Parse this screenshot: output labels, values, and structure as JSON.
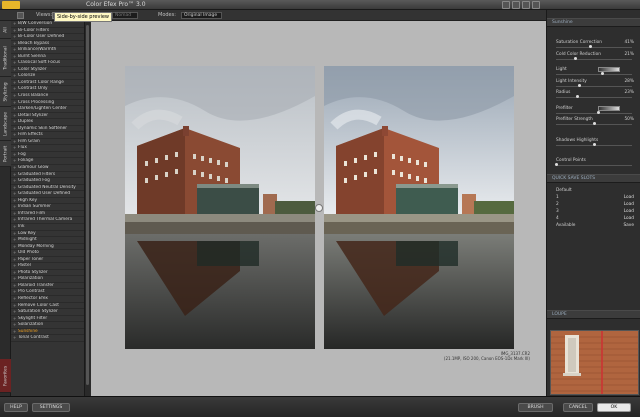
{
  "window": {
    "title": "Color Efex Pro",
    "version_sup": "™",
    "version": "3.0"
  },
  "toolbar": {
    "views_label": "Views:",
    "mode_label": "Modes:",
    "mode_value": "Original Image",
    "tooltip": "Side-by-side preview",
    "zoom_value": "Nomad"
  },
  "tabs": [
    "All",
    "Traditional",
    "Stylizing",
    "Landscape",
    "Portrait",
    "Favorites"
  ],
  "filters": [
    "B/W Conversion",
    "Bi-Color Filters",
    "Bi-Color User Defined",
    "Bleach Bypass",
    "Brilliance/Warmth",
    "Burnt Sienna",
    "Classical Soft Focus",
    "Color Stylizer",
    "Colorize",
    "Contrast Color Range",
    "Contrast Only",
    "Cross Balance",
    "Cross Processing",
    "Darken/Lighten Center",
    "Detail Stylizer",
    "Duplex",
    "Dynamic Skin Softener",
    "Film Effects",
    "Film Grain",
    "Flux",
    "Fog",
    "Foliage",
    "Glamour Glow",
    "Graduated Filters",
    "Graduated Fog",
    "Graduated Neutral Density",
    "Graduated User Defined",
    "High Key",
    "Indian Summer",
    "Infrared Film",
    "Infrared Thermal Camera",
    "Ink",
    "Low Key",
    "Midnight",
    "Monday Morning",
    "Old Photo",
    "Paper Toner",
    "Pastel",
    "Photo Stylizer",
    "Polarization",
    "Polaroid Transfer",
    "Pro Contrast",
    "Reflector Efex",
    "Remove Color Cast",
    "Saturation Stylizer",
    "Skylight Filter",
    "Solarization",
    "Sunshine",
    "Tonal Contrast"
  ],
  "active_filter": "Sunshine",
  "image_caption": {
    "file": "IMG_3137.CR2",
    "meta": "(21.1MP, ISO 200, Canon EOS-1Ds Mark III)"
  },
  "panel": {
    "filter_title": "Sunshine",
    "params": [
      {
        "label": "Saturation Correction",
        "value": "41%",
        "knob": 0.45
      },
      {
        "label": "Cold Color Reduction",
        "value": "21%",
        "knob": 0.25
      },
      {
        "label": "Light",
        "value": "",
        "knob": 0.6,
        "gradient": true
      },
      {
        "label": "Light Intensity",
        "value": "28%",
        "knob": 0.3
      },
      {
        "label": "Radius",
        "value": "23%",
        "knob": 0.28
      },
      {
        "label": "Prefilter",
        "value": "",
        "knob": 0.55,
        "gradient": true
      },
      {
        "label": "Prefilter Strength",
        "value": "50%",
        "knob": 0.5
      },
      {
        "label": "Shadows Highlights",
        "value": "",
        "knob": 0.5
      },
      {
        "label": "Control Points",
        "value": "",
        "knob": 0.0
      }
    ],
    "quick_save_title": "QUICK SAVE SLOTS",
    "slots": [
      {
        "name": "Default",
        "action": ""
      },
      {
        "name": "1",
        "action": "Load"
      },
      {
        "name": "2",
        "action": "Load"
      },
      {
        "name": "3",
        "action": "Load"
      },
      {
        "name": "4",
        "action": "Load"
      },
      {
        "name": "Available",
        "action": "Save"
      }
    ],
    "loupe_title": "LOUPE"
  },
  "bottom": {
    "help": "HELP",
    "settings": "SETTINGS",
    "brush": "BRUSH",
    "cancel": "CANCEL",
    "ok": "OK"
  },
  "colors": {
    "accent": "#f0a020",
    "ok_button": "#e9e9e9"
  }
}
